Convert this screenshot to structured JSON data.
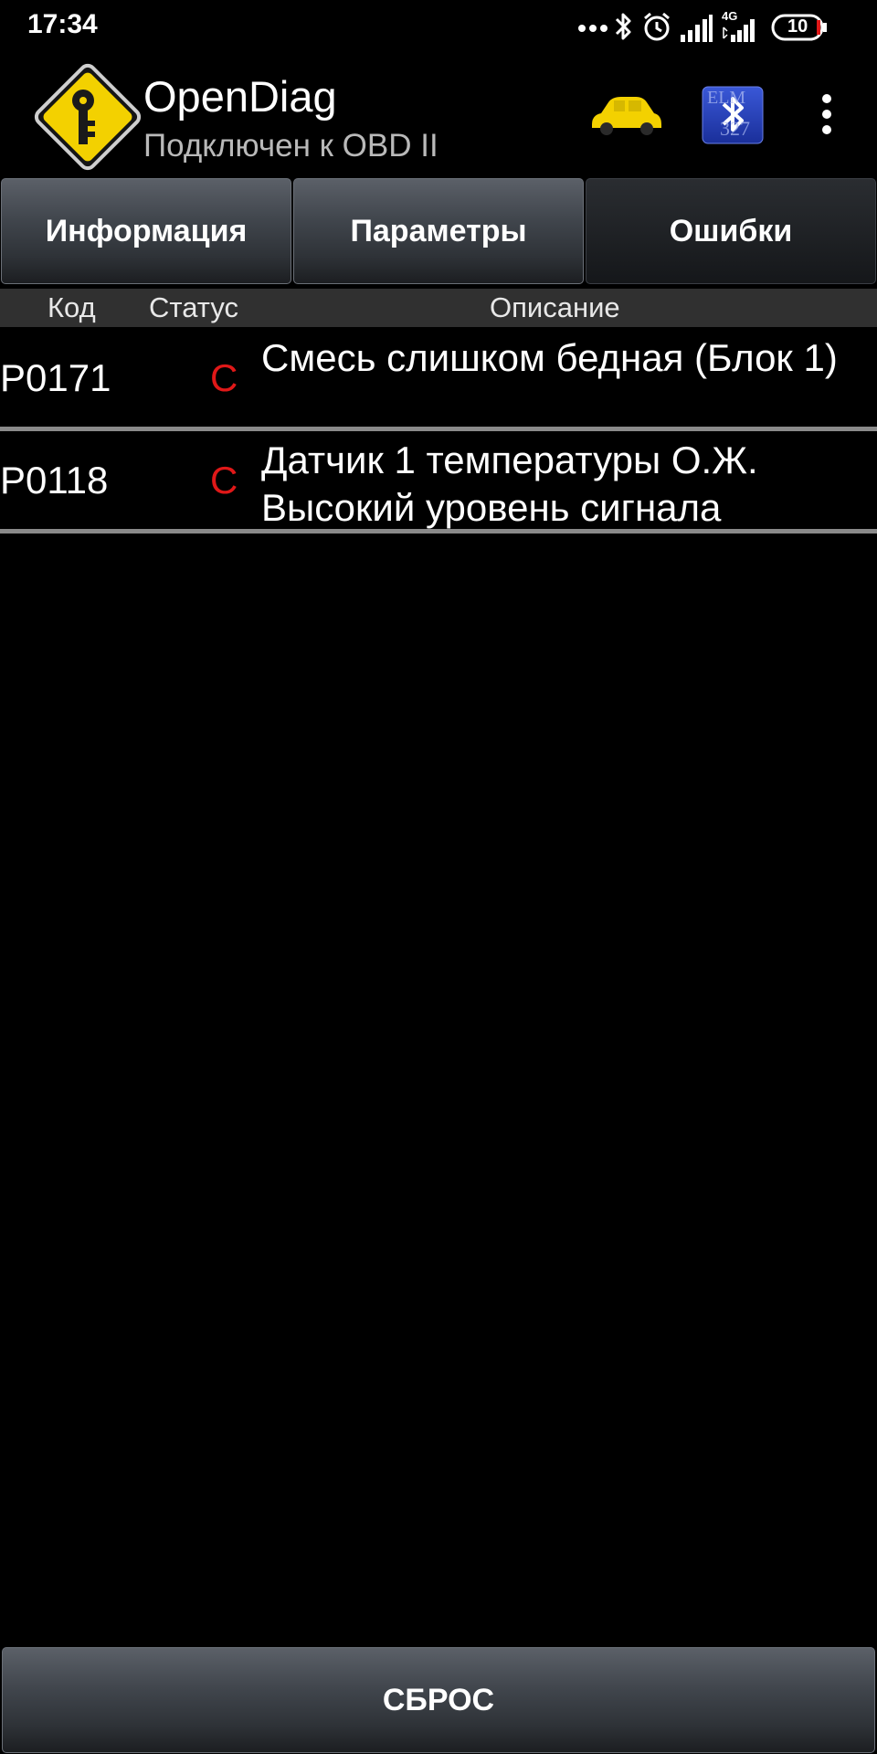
{
  "status_bar": {
    "time": "17:34",
    "network_label": "4G",
    "battery": "10"
  },
  "app": {
    "title": "OpenDiag",
    "subtitle": "Подключен к OBD II"
  },
  "toolbar": {
    "car_icon": "car-icon",
    "bluetooth_icon": "bluetooth-elm327-icon",
    "bluetooth_label_top": "ELM",
    "bluetooth_label_bottom": "327",
    "overflow_icon": "more-vert-icon"
  },
  "tabs": [
    {
      "label": "Информация",
      "active": false
    },
    {
      "label": "Параметры",
      "active": false
    },
    {
      "label": "Ошибки",
      "active": true
    }
  ],
  "table": {
    "columns": [
      "Код",
      "Статус",
      "Описание"
    ],
    "rows": [
      {
        "code": "P0171",
        "status": "C",
        "description": "Смесь слишком бедная (Блок 1)"
      },
      {
        "code": "P0118",
        "status": "C",
        "description": "Датчик 1 температуры О.Ж. Высокий уровень сигнала"
      }
    ]
  },
  "footer": {
    "reset_label": "СБРОС"
  },
  "colors": {
    "background": "#000000",
    "status_error": "#e01818",
    "car_yellow": "#f3d100",
    "tab_gray": "#40454c"
  }
}
